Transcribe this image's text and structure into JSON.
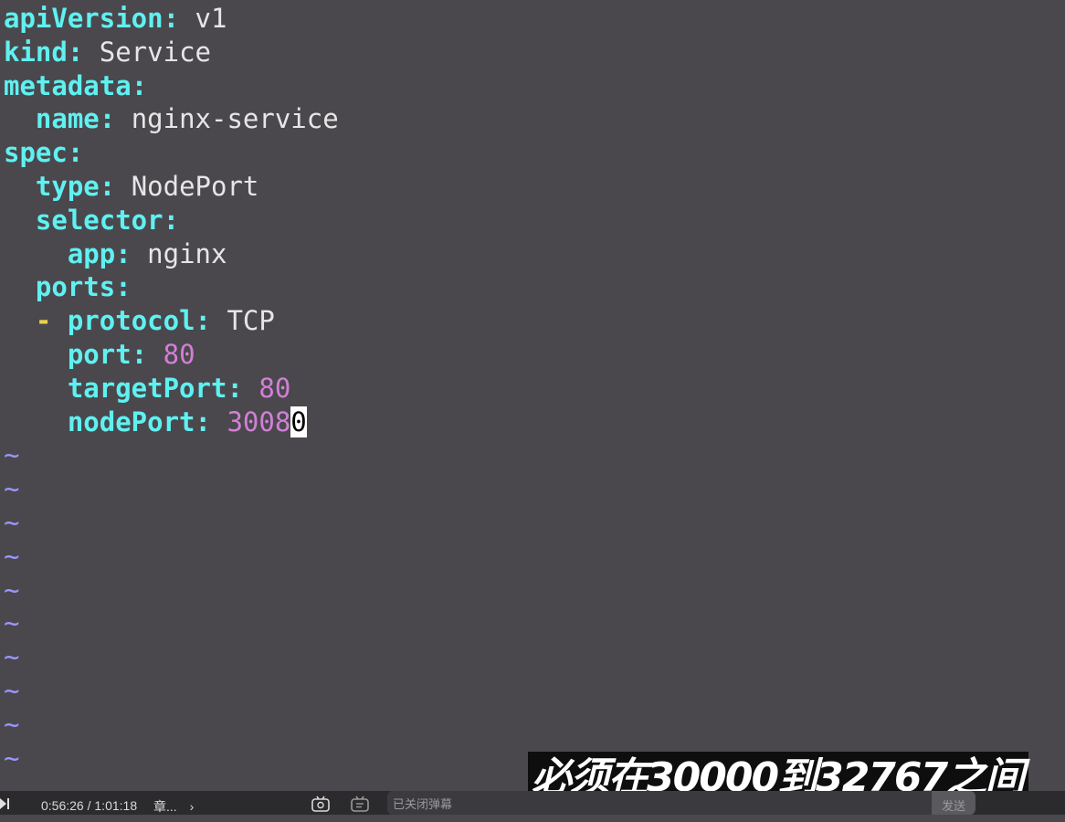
{
  "editor": {
    "lines": [
      [
        {
          "t": "apiVersion",
          "c": "key"
        },
        {
          "t": ": ",
          "c": "punct"
        },
        {
          "t": "v1",
          "c": "val"
        }
      ],
      [
        {
          "t": "kind",
          "c": "key"
        },
        {
          "t": ": ",
          "c": "punct"
        },
        {
          "t": "Service",
          "c": "val"
        }
      ],
      [
        {
          "t": "metadata",
          "c": "key"
        },
        {
          "t": ":",
          "c": "punct"
        }
      ],
      [
        {
          "t": "  ",
          "c": "val"
        },
        {
          "t": "name",
          "c": "key"
        },
        {
          "t": ": ",
          "c": "punct"
        },
        {
          "t": "nginx-service",
          "c": "val"
        }
      ],
      [
        {
          "t": "spec",
          "c": "key"
        },
        {
          "t": ":",
          "c": "punct"
        }
      ],
      [
        {
          "t": "  ",
          "c": "val"
        },
        {
          "t": "type",
          "c": "key"
        },
        {
          "t": ": ",
          "c": "punct"
        },
        {
          "t": "NodePort",
          "c": "val"
        }
      ],
      [
        {
          "t": "  ",
          "c": "val"
        },
        {
          "t": "selector",
          "c": "key"
        },
        {
          "t": ":",
          "c": "punct"
        }
      ],
      [
        {
          "t": "    ",
          "c": "val"
        },
        {
          "t": "app",
          "c": "key"
        },
        {
          "t": ": ",
          "c": "punct"
        },
        {
          "t": "nginx",
          "c": "val"
        }
      ],
      [
        {
          "t": "  ",
          "c": "val"
        },
        {
          "t": "ports",
          "c": "key"
        },
        {
          "t": ":",
          "c": "punct"
        }
      ],
      [
        {
          "t": "  ",
          "c": "val"
        },
        {
          "t": "-",
          "c": "dash"
        },
        {
          "t": " ",
          "c": "val"
        },
        {
          "t": "protocol",
          "c": "key"
        },
        {
          "t": ": ",
          "c": "punct"
        },
        {
          "t": "TCP",
          "c": "val"
        }
      ],
      [
        {
          "t": "    ",
          "c": "val"
        },
        {
          "t": "port",
          "c": "key"
        },
        {
          "t": ": ",
          "c": "punct"
        },
        {
          "t": "80",
          "c": "num"
        }
      ],
      [
        {
          "t": "    ",
          "c": "val"
        },
        {
          "t": "targetPort",
          "c": "key"
        },
        {
          "t": ": ",
          "c": "punct"
        },
        {
          "t": "80",
          "c": "num"
        }
      ],
      [
        {
          "t": "    ",
          "c": "val"
        },
        {
          "t": "nodePort",
          "c": "key"
        },
        {
          "t": ": ",
          "c": "punct"
        },
        {
          "t": "3008",
          "c": "num"
        },
        {
          "t": "0",
          "c": "cursor"
        }
      ],
      [
        {
          "t": "~",
          "c": "tilde"
        }
      ],
      [
        {
          "t": "~",
          "c": "tilde"
        }
      ],
      [
        {
          "t": "~",
          "c": "tilde"
        }
      ],
      [
        {
          "t": "~",
          "c": "tilde"
        }
      ],
      [
        {
          "t": "~",
          "c": "tilde"
        }
      ],
      [
        {
          "t": "~",
          "c": "tilde"
        }
      ],
      [
        {
          "t": "~",
          "c": "tilde"
        }
      ],
      [
        {
          "t": "~",
          "c": "tilde"
        }
      ],
      [
        {
          "t": "~",
          "c": "tilde"
        }
      ],
      [
        {
          "t": "~",
          "c": "tilde"
        }
      ]
    ]
  },
  "subtitle": {
    "text": "必须在30000到32767之间"
  },
  "player": {
    "current_time": "0:56:26",
    "separator": "/",
    "total_time": "1:01:18",
    "chapter_label": "章...",
    "chapter_chevron": "›",
    "danmaku_placeholder": "已关闭弹幕",
    "send_label": "发送",
    "icons": [
      "play-icon",
      "danmaku-settings-icon",
      "danmaku-toggle-icon"
    ]
  },
  "colors": {
    "background": "#4a484d",
    "key": "#5ff1f1",
    "number": "#d27fd6",
    "dash": "#e8d24a",
    "tilde": "#9a97ff",
    "text": "#e6e6e6"
  }
}
